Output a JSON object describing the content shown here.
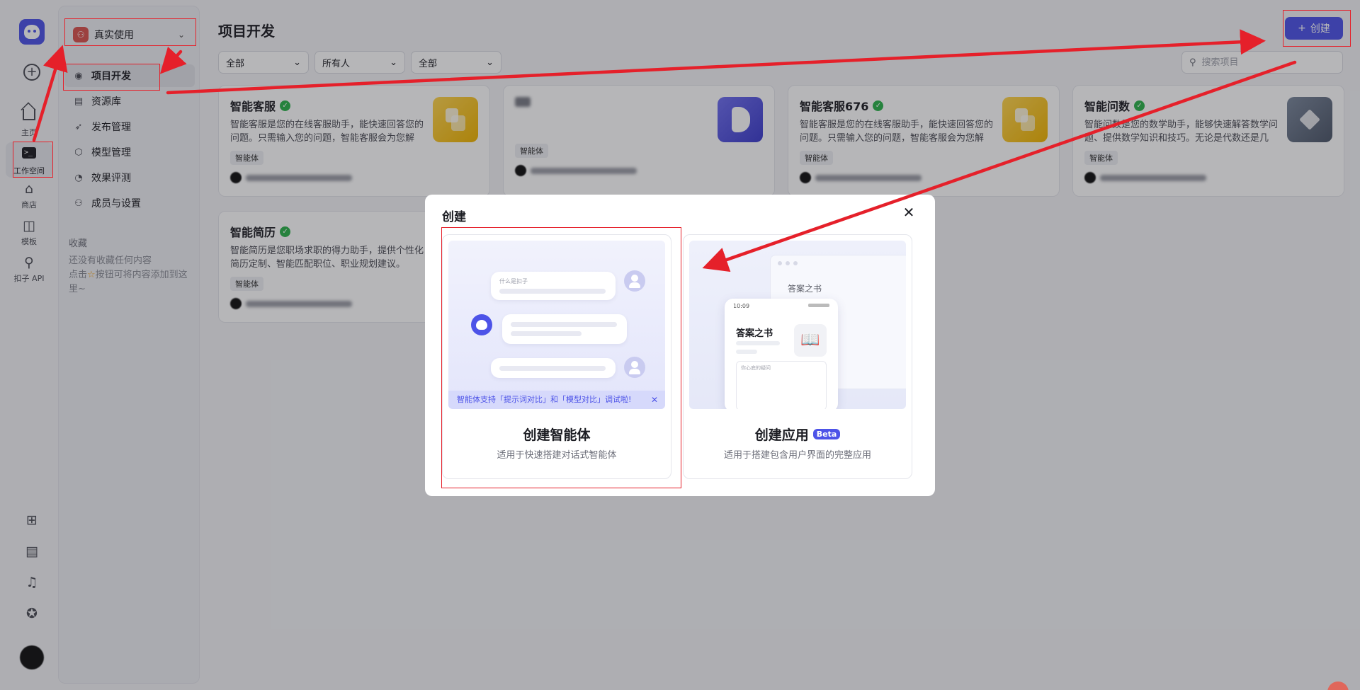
{
  "rail": {
    "items": [
      {
        "label": "主页",
        "icon": "home-icon"
      },
      {
        "label": "工作空间",
        "icon": "terminal-icon"
      },
      {
        "label": "商店",
        "icon": "store-icon"
      },
      {
        "label": "模板",
        "icon": "template-icon"
      },
      {
        "label": "扣子 API",
        "icon": "api-icon"
      }
    ]
  },
  "panel": {
    "space_name": "真实使用",
    "menu": [
      {
        "label": "项目开发",
        "icon": "bot-icon"
      },
      {
        "label": "资源库",
        "icon": "library-icon"
      },
      {
        "label": "发布管理",
        "icon": "rocket-icon"
      },
      {
        "label": "模型管理",
        "icon": "model-icon"
      },
      {
        "label": "效果评测",
        "icon": "evaluate-icon"
      },
      {
        "label": "成员与设置",
        "icon": "members-icon"
      }
    ],
    "favorites_title": "收藏",
    "favorites_empty_1": "还没有收藏任何内容",
    "favorites_empty_2a": "点击",
    "favorites_empty_2b": "按钮可将内容添加到这里~"
  },
  "main": {
    "title": "项目开发",
    "create_label": "创建",
    "filters": [
      "全部",
      "所有人",
      "全部"
    ],
    "search_placeholder": "搜索项目",
    "cards": [
      {
        "title": "智能客服",
        "desc": "智能客服是您的在线客服助手，能快速回答您的问题。只需输入您的问题，智能客服会为您解答。",
        "tag": "智能体",
        "thumb": "yellow"
      },
      {
        "title": "",
        "desc": "",
        "tag": "智能体",
        "thumb": "blue"
      },
      {
        "title": "智能客服676",
        "desc": "智能客服是您的在线客服助手，能快速回答您的问题。只需输入您的问题，智能客服会为您解答。",
        "tag": "智能体",
        "thumb": "yellow"
      },
      {
        "title": "智能问数",
        "desc": "智能问数是您的数学助手，能够快速解答数学问题、提供数学知识和技巧。无论是代数还是几何。",
        "tag": "智能体",
        "thumb": "gray"
      },
      {
        "title": "智能简历",
        "desc": "智能简历是您职场求职的得力助手，提供个性化简历定制、智能匹配职位、职业规划建议。",
        "tag": "智能体",
        "thumb": ""
      }
    ]
  },
  "modal": {
    "title": "创建",
    "agent": {
      "title": "创建智能体",
      "subtitle": "适用于快速搭建对话式智能体",
      "chat_hint": "什么是扣子",
      "notice": "智能体支持「提示词对比」和「模型对比」调试啦!"
    },
    "app": {
      "title": "创建应用",
      "badge": "Beta",
      "subtitle": "适用于搭建包含用户界面的完整应用",
      "window_title": "答案之书",
      "phone_title": "答案之书",
      "phone_time": "10:09",
      "phone_input": "你心底的疑问"
    }
  },
  "colors": {
    "accent": "#4d53e8",
    "annotation": "#e5202a",
    "check": "#2bb34a"
  }
}
